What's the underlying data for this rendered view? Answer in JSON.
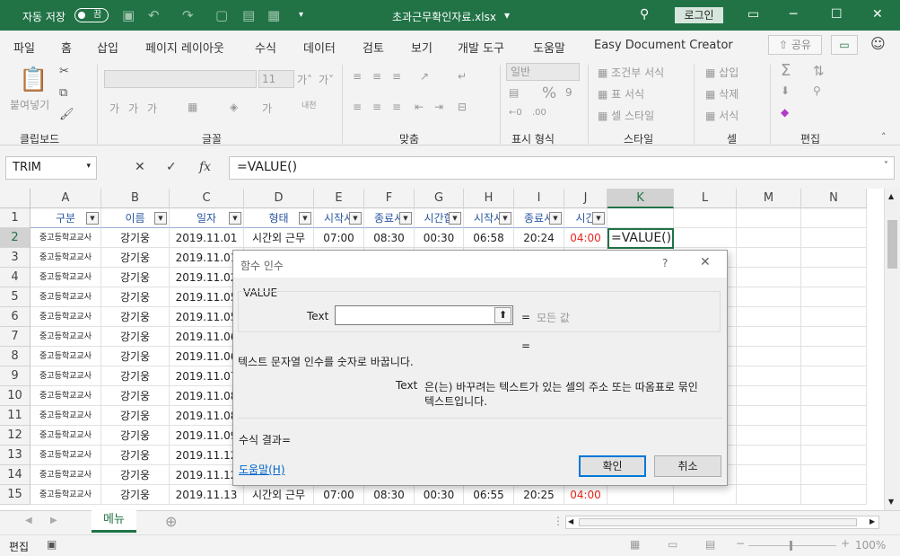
{
  "titlebar": {
    "autosave": "자동 저장",
    "toggle": "끔",
    "filename": "초과근무확인자료.xlsx",
    "dropdown": "▾",
    "login": "로그인"
  },
  "tabs": [
    "파일",
    "홈",
    "삽입",
    "페이지 레이아웃",
    "수식",
    "데이터",
    "검토",
    "보기",
    "개발 도구",
    "도움말",
    "Easy Document Creator"
  ],
  "share": "공유",
  "ribbon": {
    "paste": "붙여넣기",
    "font_size": "11",
    "number_format": "일반",
    "cond_format": "조건부 서식",
    "table_format": "표 서식",
    "cell_style": "셀 스타일",
    "insert": "삽입",
    "delete": "삭제",
    "format": "서식",
    "groups": [
      "클립보드",
      "글꼴",
      "맞춤",
      "표시 형식",
      "스타일",
      "셀",
      "편집"
    ]
  },
  "formula_bar": {
    "namebox": "TRIM",
    "formula": "=VALUE()"
  },
  "columns": [
    "A",
    "B",
    "C",
    "D",
    "E",
    "F",
    "G",
    "H",
    "I",
    "J",
    "K",
    "L",
    "M",
    "N"
  ],
  "header_row": [
    "구분",
    "이름",
    "일자",
    "형태",
    "시작시",
    "종료시",
    "시간합",
    "시작시",
    "종료시",
    "시간"
  ],
  "rows": [
    {
      "n": "1"
    },
    {
      "n": "2",
      "a": "중고등학교교사",
      "b": "강기웅",
      "c": "2019.11.01",
      "d": "시간외 근무",
      "e": "07:00",
      "f": "08:30",
      "g": "00:30",
      "h": "06:58",
      "i": "20:24",
      "j": "04:00",
      "k": "=VALUE()"
    },
    {
      "n": "3",
      "a": "중고등학교교사",
      "b": "강기웅",
      "c": "2019.11.01"
    },
    {
      "n": "4",
      "a": "중고등학교교사",
      "b": "강기웅",
      "c": "2019.11.02"
    },
    {
      "n": "5",
      "a": "중고등학교교사",
      "b": "강기웅",
      "c": "2019.11.05"
    },
    {
      "n": "6",
      "a": "중고등학교교사",
      "b": "강기웅",
      "c": "2019.11.05"
    },
    {
      "n": "7",
      "a": "중고등학교교사",
      "b": "강기웅",
      "c": "2019.11.06"
    },
    {
      "n": "8",
      "a": "중고등학교교사",
      "b": "강기웅",
      "c": "2019.11.06"
    },
    {
      "n": "9",
      "a": "중고등학교교사",
      "b": "강기웅",
      "c": "2019.11.07"
    },
    {
      "n": "10",
      "a": "중고등학교교사",
      "b": "강기웅",
      "c": "2019.11.08"
    },
    {
      "n": "11",
      "a": "중고등학교교사",
      "b": "강기웅",
      "c": "2019.11.08"
    },
    {
      "n": "12",
      "a": "중고등학교교사",
      "b": "강기웅",
      "c": "2019.11.09"
    },
    {
      "n": "13",
      "a": "중고등학교교사",
      "b": "강기웅",
      "c": "2019.11.12"
    },
    {
      "n": "14",
      "a": "중고등학교교사",
      "b": "강기웅",
      "c": "2019.11.12"
    },
    {
      "n": "15",
      "a": "중고등학교교사",
      "b": "강기웅",
      "c": "2019.11.13",
      "d": "시간외 근무",
      "e": "07:00",
      "f": "08:30",
      "g": "00:30",
      "h": "06:55",
      "i": "20:25",
      "j": "04:00"
    }
  ],
  "sheet_tab": "메뉴",
  "status": {
    "mode": "편집",
    "zoom": "100%"
  },
  "dialog": {
    "title": "함수 인수",
    "help_q": "?",
    "close": "✕",
    "func": "VALUE",
    "arg_label": "Text",
    "eq1": "=",
    "arg_hint": "모든 값",
    "eq2": "=",
    "description": "텍스트 문자열 인수를 숫자로 바꿉니다.",
    "arg_name": "Text",
    "arg_desc_line1": "은(는) 바꾸려는 텍스트가 있는 셀의 주소 또는 따옴표로 묶인",
    "arg_desc_line2": "텍스트입니다.",
    "result": "수식 결과=",
    "help_link": "도움말(H)",
    "ok": "확인",
    "cancel": "취소"
  },
  "colors": {
    "excel_green": "#217346",
    "error_red": "#e8251d",
    "link_blue": "#2a56a0"
  }
}
